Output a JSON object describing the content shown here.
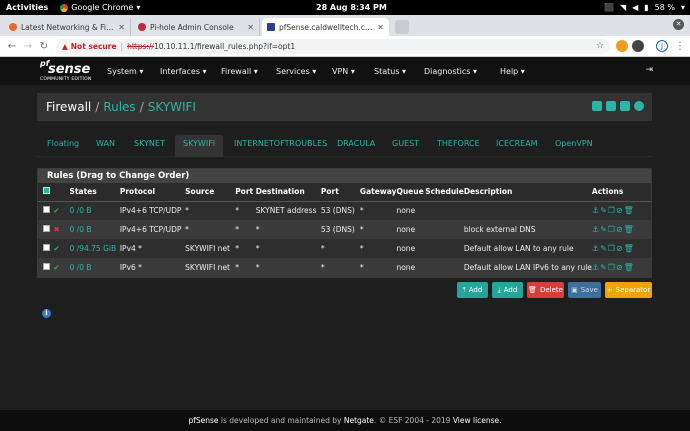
{
  "system_bar": {
    "activities": "Activities",
    "app_name": "Google Chrome",
    "clock": "28 Aug   8:34 PM",
    "battery": "58 %"
  },
  "browser": {
    "tabs": [
      {
        "title": "Latest Networking & Firewall",
        "active": false
      },
      {
        "title": "Pi-hole Admin Console",
        "active": false
      },
      {
        "title": "pfSense.caldwelltech.co.uk -",
        "active": true
      }
    ],
    "not_secure": "Not secure",
    "url_scheme": "https://",
    "url_rest": "10.10.11.1/firewall_rules.php?if=opt1",
    "profile_initial": "J"
  },
  "navbar": {
    "logo_pf": "pf",
    "logo_sense": "sense",
    "logo_edition": "COMMUNITY EDITION",
    "menu": [
      "System ▾",
      "Interfaces ▾",
      "Firewall ▾",
      "Services ▾",
      "VPN ▾",
      "Status ▾",
      "Diagnostics ▾",
      "Help ▾"
    ]
  },
  "breadcrumb": {
    "part1": "Firewall",
    "sep": "/",
    "part2": "Rules",
    "part3": "SKYWIFI"
  },
  "interface_tabs": [
    "Floating",
    "WAN",
    "SKYNET",
    "SKYWIFI",
    "INTERNETOFTROUBLES",
    "DRACULA",
    "GUEST",
    "THEFORCE",
    "ICECREAM",
    "OpenVPN"
  ],
  "active_interface": "SKYWIFI",
  "rules_panel": {
    "title": "Rules (Drag to Change Order)",
    "columns": [
      "States",
      "Protocol",
      "Source",
      "Port",
      "Destination",
      "Port",
      "Gateway",
      "Queue",
      "Schedule",
      "Description",
      "Actions"
    ],
    "rows": [
      {
        "status": "pass",
        "states": "0 /0 B",
        "protocol": "IPv4+6 TCP/UDP",
        "source": "*",
        "sport": "*",
        "destination": "SKYNET address",
        "dport": "53 (DNS)",
        "gateway": "*",
        "queue": "none",
        "schedule": "",
        "description": ""
      },
      {
        "status": "block",
        "states": "0 /0 B",
        "protocol": "IPv4+6 TCP/UDP",
        "source": "*",
        "sport": "*",
        "destination": "*",
        "dport": "53 (DNS)",
        "gateway": "*",
        "queue": "none",
        "schedule": "",
        "description": "block external DNS"
      },
      {
        "status": "pass",
        "states": "0 /94.75 GiB",
        "protocol": "IPv4 *",
        "source": "SKYWIFI net",
        "sport": "*",
        "destination": "*",
        "dport": "*",
        "gateway": "*",
        "queue": "none",
        "schedule": "",
        "description": "Default allow LAN to any rule"
      },
      {
        "status": "pass",
        "states": "0 /0 B",
        "protocol": "IPv6 *",
        "source": "SKYWIFI net",
        "sport": "*",
        "destination": "*",
        "dport": "*",
        "gateway": "*",
        "queue": "none",
        "schedule": "",
        "description": "Default allow LAN IPv6 to any rule"
      }
    ]
  },
  "buttons": {
    "add_top": "Add",
    "add_bottom": "Add",
    "delete": "Delete",
    "save": "Save",
    "separator": "Separator"
  },
  "footer": {
    "brand": "pfSense",
    "text1": " is developed and maintained by ",
    "company": "Netgate",
    "text2": ". © ESF 2004 - 2019 ",
    "license": "View license."
  },
  "colors": {
    "accent": "#29b6a8",
    "pass": "#2fb34c",
    "block": "#d8373a",
    "delete": "#d43f3a",
    "separator": "#f0a30a"
  }
}
